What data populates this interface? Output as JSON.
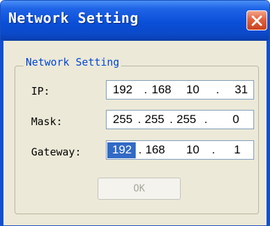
{
  "window": {
    "title": "Network Setting"
  },
  "group": {
    "legend": "Network Setting"
  },
  "fields": {
    "ip": {
      "label": "IP:",
      "octets": [
        "192",
        "168",
        "10",
        "31"
      ]
    },
    "mask": {
      "label": "Mask:",
      "octets": [
        "255",
        "255",
        "255",
        "0"
      ]
    },
    "gateway": {
      "label": "Gateway:",
      "octets": [
        "192",
        "168",
        "10",
        "1"
      ]
    }
  },
  "ok_button": {
    "label": "OK",
    "enabled": false
  },
  "colors": {
    "titlebar": "#0a4fd8",
    "close": "#e2623e",
    "legend": "#0046d5",
    "selection": "#316ac5"
  },
  "icons": {
    "close": "close-icon"
  }
}
